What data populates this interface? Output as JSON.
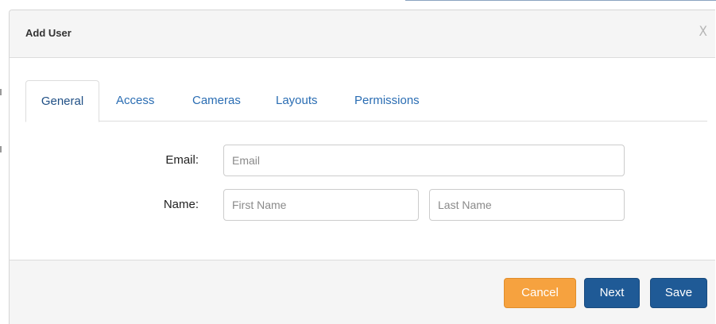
{
  "dialog": {
    "title": "Add User",
    "close_label": "X"
  },
  "tabs": [
    {
      "label": "General",
      "active": true
    },
    {
      "label": "Access",
      "active": false
    },
    {
      "label": "Cameras",
      "active": false
    },
    {
      "label": "Layouts",
      "active": false
    },
    {
      "label": "Permissions",
      "active": false
    }
  ],
  "form": {
    "email": {
      "label": "Email:",
      "value": "",
      "placeholder": "Email"
    },
    "name": {
      "label": "Name:",
      "first_name": {
        "value": "",
        "placeholder": "First Name"
      },
      "last_name": {
        "value": "",
        "placeholder": "Last Name"
      }
    }
  },
  "footer": {
    "cancel_label": "Cancel",
    "next_label": "Next",
    "save_label": "Save"
  },
  "colors": {
    "primary": "#1f5a96",
    "warning": "#f6a23f",
    "tab_link": "#2a6db3",
    "header_bg": "#f5f5f5"
  }
}
